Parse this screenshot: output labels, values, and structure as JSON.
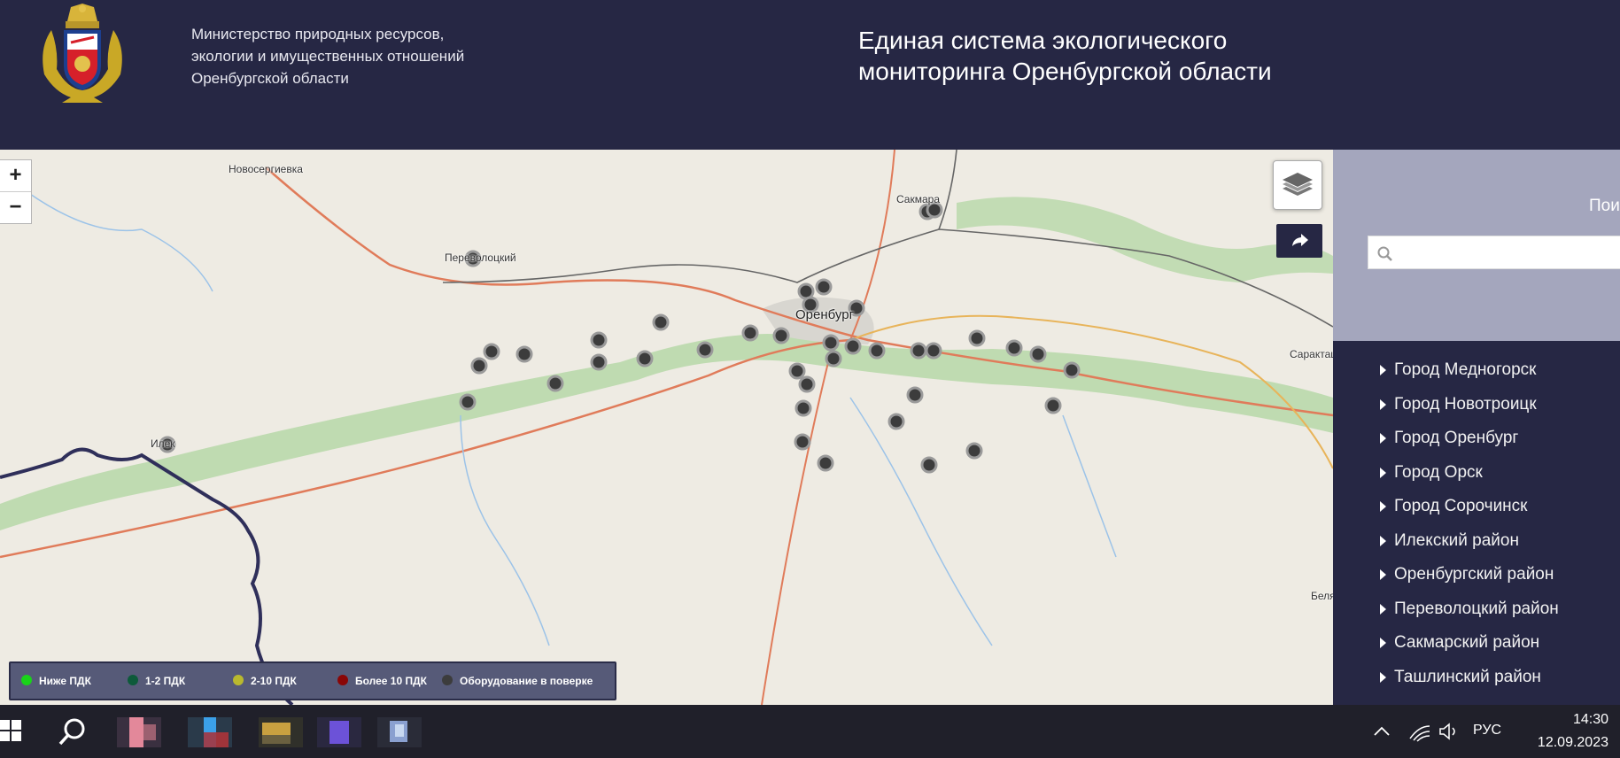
{
  "header": {
    "ministry_line1": "Министерство природных ресурсов,",
    "ministry_line2": "экологии и имущественных отношений",
    "ministry_line3": "Оренбургской области",
    "title_line1": "Единая система экологического",
    "title_line2": "мониторинга Оренбургской области",
    "emblem_icon": "coat-of-arms-icon"
  },
  "map": {
    "zoom_in": "+",
    "zoom_out": "−",
    "layers_icon": "layers-icon",
    "share_icon": "share-arrow-icon",
    "towns": {
      "novosergievka": "Новосергиевка",
      "perevolotsky": "Переволоцкий",
      "sakmara": "Сакмара",
      "orenburg": "Оренбург",
      "saraktash": "Саракташ",
      "ilek": "Илек",
      "belyaevka": "Беля"
    },
    "marker_count": 38
  },
  "legend": {
    "items": [
      {
        "label": "Ниже ПДК",
        "color": "#19d319"
      },
      {
        "label": "1-2 ПДК",
        "color": "#0d5a3a"
      },
      {
        "label": "2-10 ПДК",
        "color": "#b9b92e"
      },
      {
        "label": "Более 10 ПДК",
        "color": "#8a0606"
      },
      {
        "label": "Оборудование в поверке",
        "color": "#3c3c3c"
      }
    ]
  },
  "sidebar": {
    "search_label": "Пои",
    "search_placeholder": "",
    "districts": [
      "Город Медногорск",
      "Город Новотроицк",
      "Город Оренбург",
      "Город Орск",
      "Город Сорочинск",
      "Илекский район",
      "Оренбургский район",
      "Переволоцкий район",
      "Сакмарский район",
      "Ташлинский район"
    ]
  },
  "taskbar": {
    "language": "РУС",
    "time": "14:30",
    "date": "12.09.2023"
  }
}
